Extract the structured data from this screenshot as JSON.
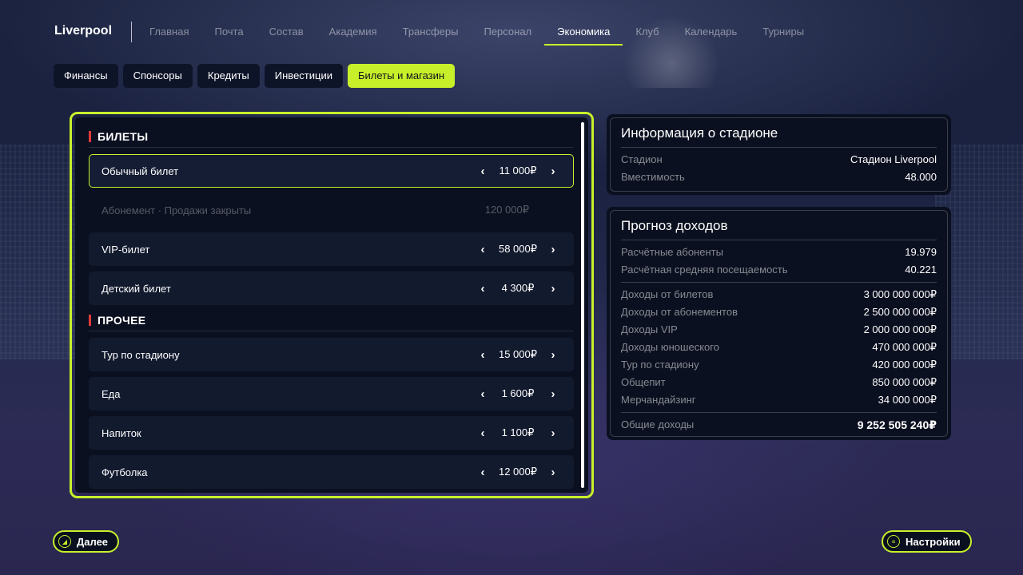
{
  "nav": {
    "club": "Liverpool",
    "items": [
      {
        "label": "Главная"
      },
      {
        "label": "Почта"
      },
      {
        "label": "Состав"
      },
      {
        "label": "Академия"
      },
      {
        "label": "Трансферы"
      },
      {
        "label": "Персонал"
      },
      {
        "label": "Экономика",
        "active": true
      },
      {
        "label": "Клуб"
      },
      {
        "label": "Календарь"
      },
      {
        "label": "Турниры"
      }
    ]
  },
  "subtabs": [
    {
      "label": "Финансы"
    },
    {
      "label": "Спонсоры"
    },
    {
      "label": "Кредиты"
    },
    {
      "label": "Инвестиции"
    },
    {
      "label": "Билеты и магазин",
      "active": true
    }
  ],
  "tickets": {
    "title": "БИЛЕТЫ",
    "rows": [
      {
        "label": "Обычный билет",
        "price": "11 000₽"
      },
      {
        "label": "Абонемент  ·  Продажи закрыты",
        "price": "120 000₽"
      },
      {
        "label": "VIP-билет",
        "price": "58 000₽"
      },
      {
        "label": "Детский билет",
        "price": "4 300₽"
      }
    ]
  },
  "other": {
    "title": "ПРОЧЕЕ",
    "rows": [
      {
        "label": "Тур по стадиону",
        "price": "15 000₽"
      },
      {
        "label": "Еда",
        "price": "1 600₽"
      },
      {
        "label": "Напиток",
        "price": "1 100₽"
      },
      {
        "label": "Футболка",
        "price": "12 000₽"
      }
    ]
  },
  "stadium": {
    "title": "Информация о стадионе",
    "rows": [
      {
        "k": "Стадион",
        "v": "Стадион Liverpool"
      },
      {
        "k": "Вместимость",
        "v": "48.000"
      }
    ]
  },
  "forecast": {
    "title": "Прогноз доходов",
    "top": [
      {
        "k": "Расчётные абоненты",
        "v": "19.979"
      },
      {
        "k": "Расчётная средняя посещаемость",
        "v": "40.221"
      }
    ],
    "income": [
      {
        "k": "Доходы от билетов",
        "v": "3 000 000 000₽"
      },
      {
        "k": "Доходы от абонементов",
        "v": "2 500 000 000₽"
      },
      {
        "k": "Доходы VIP",
        "v": "2 000 000 000₽"
      },
      {
        "k": "Доходы юношеского",
        "v": "470 000 000₽"
      },
      {
        "k": "Тур по стадиону",
        "v": "420 000 000₽"
      },
      {
        "k": "Общепит",
        "v": "850 000 000₽"
      },
      {
        "k": "Мерчандайзинг",
        "v": "34 000 000₽"
      }
    ],
    "total": {
      "k": "Общие доходы",
      "v": "9 252 505 240₽"
    }
  },
  "buttons": {
    "next": "Далее",
    "settings": "Настройки"
  },
  "colors": {
    "accent": "#c8f02a",
    "section_mark": "#e23a3a"
  }
}
